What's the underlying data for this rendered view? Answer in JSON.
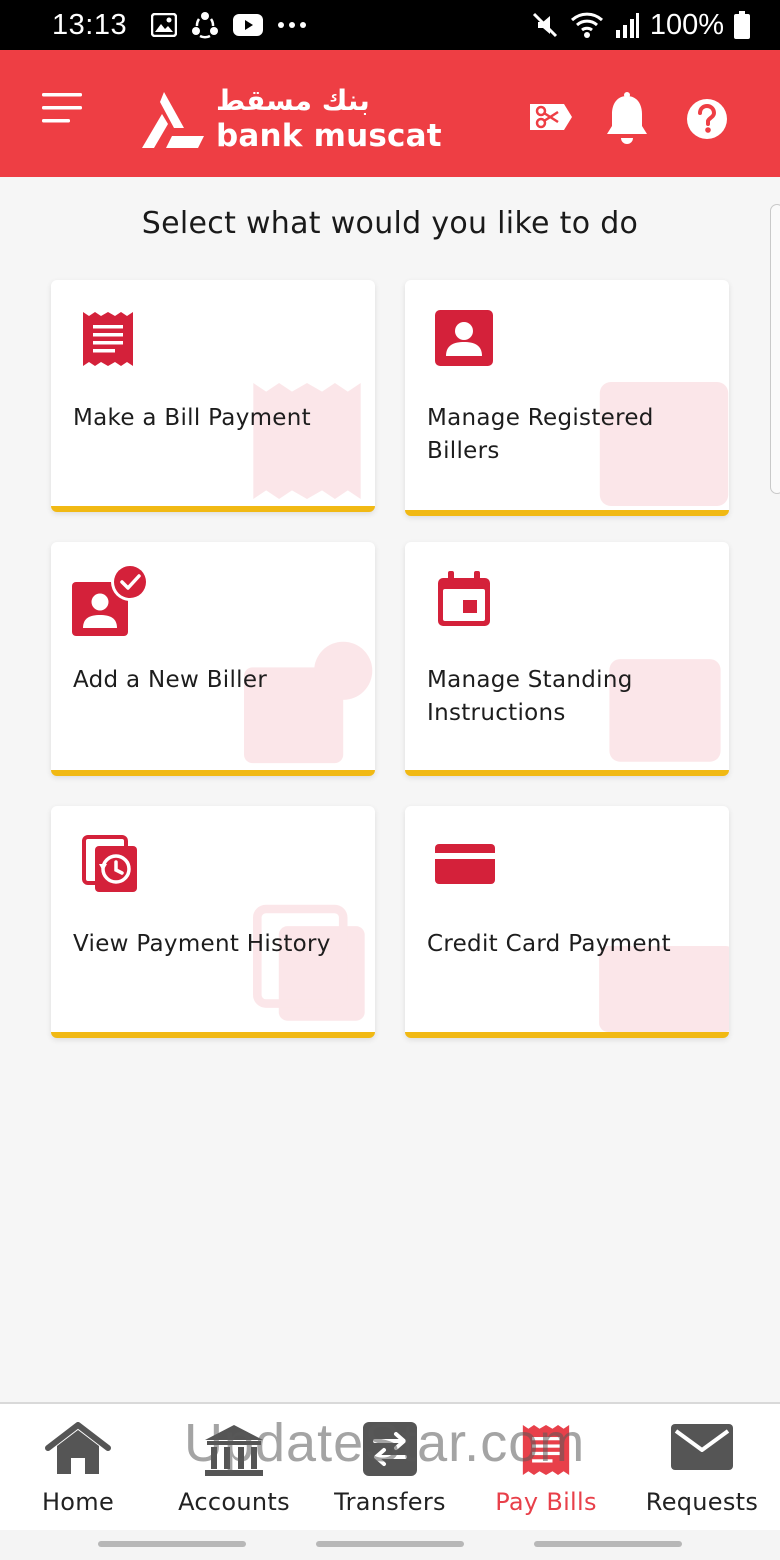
{
  "status_bar": {
    "time": "13:13",
    "battery": "100%"
  },
  "header": {
    "brand_en": "bank muscat",
    "brand_ar": "بنك مسقط",
    "colors": {
      "primary": "#ee3e44",
      "accent": "#f1b914"
    }
  },
  "page": {
    "title": "Select what would you like to do"
  },
  "tiles": [
    {
      "label": "Make a Bill Payment",
      "icon": "bill-receipt-icon"
    },
    {
      "label": "Manage Registered Billers",
      "icon": "user-profile-icon"
    },
    {
      "label": "Add a New Biller",
      "icon": "add-user-check-icon"
    },
    {
      "label": "Manage Standing Instructions",
      "icon": "calendar-icon"
    },
    {
      "label": "View Payment History",
      "icon": "history-icon"
    },
    {
      "label": "Credit Card Payment",
      "icon": "credit-card-icon"
    }
  ],
  "nav": {
    "items": [
      {
        "label": "Home",
        "icon": "home-icon"
      },
      {
        "label": "Accounts",
        "icon": "bank-building-icon"
      },
      {
        "label": "Transfers",
        "icon": "transfer-arrows-icon"
      },
      {
        "label": "Pay Bills",
        "icon": "bill-receipt-icon",
        "active": true
      },
      {
        "label": "Requests",
        "icon": "mail-icon"
      }
    ]
  },
  "watermark": "UpdateStar.com"
}
